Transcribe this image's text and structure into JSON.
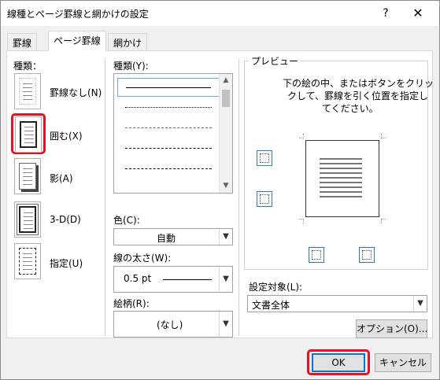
{
  "title": "線種とページ罫線と網かけの設定",
  "titlebar": {
    "help": "?",
    "close": "✕"
  },
  "tabs": [
    "罫線",
    "ページ罫線",
    "網かけ"
  ],
  "setting": {
    "label": "種類：",
    "options": [
      "罫線なし(N)",
      "囲む(X)",
      "影(A)",
      "3-D(D)",
      "指定(U)"
    ],
    "selected": "囲む(X)"
  },
  "style": {
    "label": "種類(Y):"
  },
  "color": {
    "label": "色(C):",
    "value": "自動"
  },
  "width": {
    "label": "線の太さ(W):",
    "value": "0.5 pt"
  },
  "art": {
    "label": "絵柄(R):",
    "value": "(なし)"
  },
  "preview": {
    "label": "プレビュー",
    "instructions": [
      "下の絵の中、またはボタンをクリッ",
      "クして、罫線を引く位置を指定し",
      "てください。"
    ]
  },
  "apply_to": {
    "label": "設定対象(L):",
    "value": "文書全体"
  },
  "options_button": "オプション(O)...",
  "ok_button": "OK",
  "cancel_button": "キャンセル",
  "colors": {
    "highlight": "#e81123",
    "accent": "#0078d7"
  },
  "icons": [
    "help-icon",
    "close-icon",
    "chevron-down-icon",
    "chevron-up-icon"
  ]
}
